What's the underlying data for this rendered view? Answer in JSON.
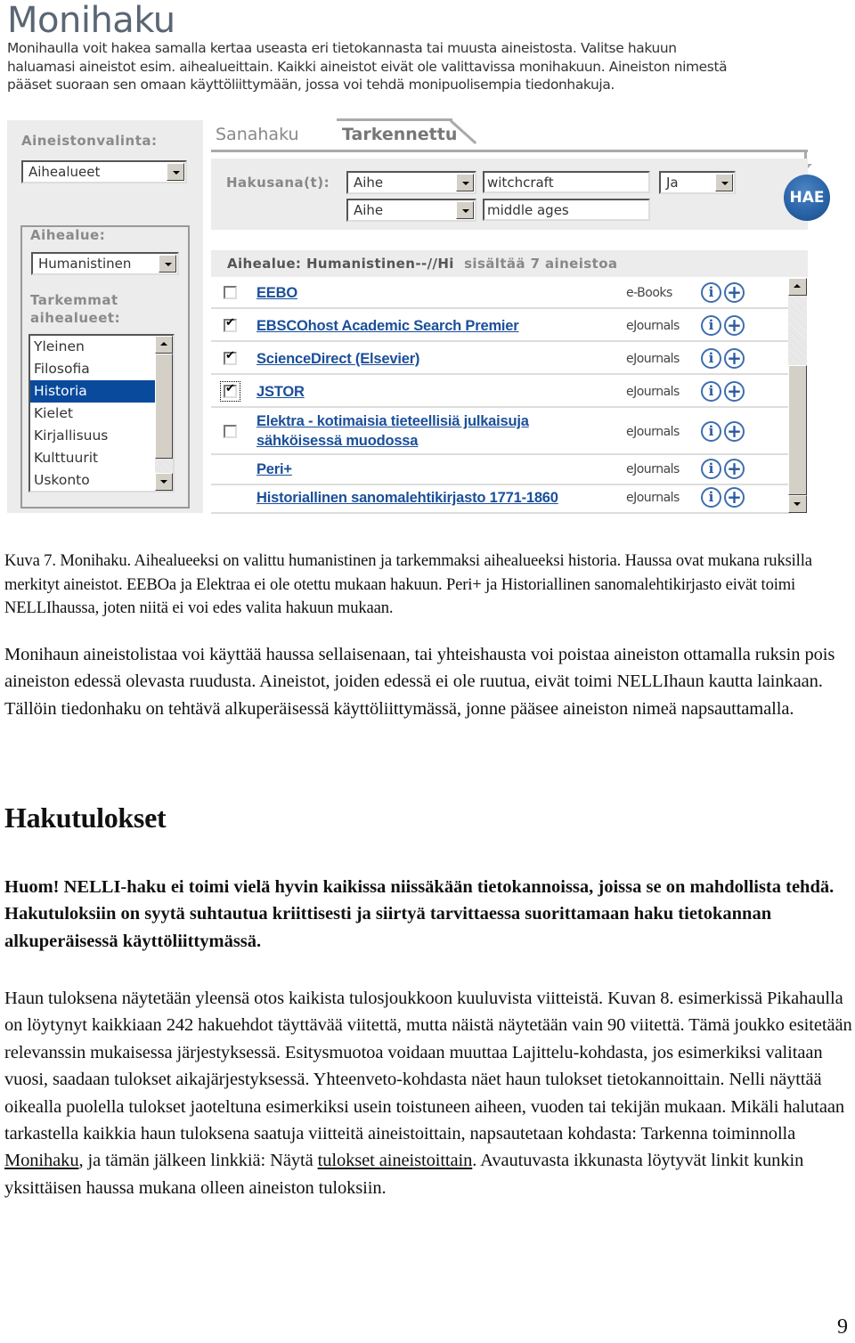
{
  "app": {
    "title": "Monihaku",
    "intro_lines": [
      "Monihaulla voit hakea samalla kertaa useasta eri tietokannasta tai muusta aineistosta. Valitse hakuun",
      "haluamasi aineistot esim. aihealueittain. Kaikki aineistot eivät ole valittavissa monihakuun. Aineiston nimestä",
      "pääset suoraan sen omaan käyttöliittymään, jossa voi tehdä monipuolisempia tiedonhakuja."
    ]
  },
  "left_panel": {
    "selection_label": "Aineistonvalinta:",
    "selection_value": "Aihealueet",
    "subject_label": "Aihealue:",
    "subject_value": "Humanistinen",
    "sub_subjects_label": "Tarkemmat aihealueet:",
    "sub_subjects": [
      "Yleinen",
      "Filosofia",
      "Historia",
      "Kielet",
      "Kirjallisuus",
      "Kulttuurit",
      "Uskonto"
    ],
    "selected_sub_subject": "Historia"
  },
  "tabs": [
    {
      "label": "Sanahaku",
      "active": false
    },
    {
      "label": "Tarkennettu",
      "active": true
    }
  ],
  "search": {
    "label": "Hakusana(t):",
    "rows": [
      {
        "field": "Aihe",
        "term": "witchcraft",
        "operator": "Ja"
      },
      {
        "field": "Aihe",
        "term": "middle ages"
      }
    ],
    "submit_label": "HAE"
  },
  "results": {
    "header_bold": "Aihealue: Humanistinen--//Hi",
    "header_rest": "sisältää 7 aineistoa",
    "items": [
      {
        "name": "EEBO",
        "type": "e-Books",
        "checkbox": true,
        "checked": false
      },
      {
        "name": "EBSCOhost Academic Search Premier",
        "type": "eJournals",
        "checkbox": true,
        "checked": true
      },
      {
        "name": "ScienceDirect (Elsevier)",
        "type": "eJournals",
        "checkbox": true,
        "checked": true
      },
      {
        "name": "JSTOR",
        "type": "eJournals",
        "checkbox": true,
        "checked": true,
        "focused": true
      },
      {
        "name_lines": [
          "Elektra - kotimaisia tieteellisiä julkaisuja",
          "sähköisessä muodossa"
        ],
        "type": "eJournals",
        "checkbox": true,
        "checked": false
      },
      {
        "name": "Peri+",
        "type": "eJournals",
        "checkbox": false
      },
      {
        "name": "Historiallinen sanomalehtikirjasto 1771-1860",
        "type": "eJournals",
        "checkbox": false
      }
    ],
    "info_icon": "i",
    "add_icon": "+"
  },
  "document": {
    "caption": "Kuva 7. Monihaku.  Aihealueeksi on valittu humanistinen ja tarkemmaksi aihealueeksi historia. Haussa ovat mukana ruksilla merkityt aineistot. EEBOa ja Elektraa ei ole otettu mukaan hakuun.  Peri+ ja Historiallinen sanomalehtikirjasto eivät toimi NELLIhaussa, joten niitä ei voi edes valita hakuun mukaan.",
    "paragraph1": "Monihaun aineistolistaa voi käyttää haussa sellaisenaan, tai yhteishausta voi poistaa aineiston ottamalla ruksin pois aineiston edessä olevasta ruudusta. Aineistot, joiden edessä ei ole ruutua, eivät toimi NELLIhaun kautta lainkaan. Tällöin tiedonhaku on tehtävä alkuperäisessä käyttöliittymässä, jonne pääsee aineiston nimeä napsauttamalla.",
    "heading": "Hakutulokset",
    "note": "Huom! NELLI-haku ei toimi vielä hyvin kaikissa niissäkään tietokannoissa, joissa se on mahdollista tehdä.  Hakutuloksiin on syytä suhtautua kriittisesti ja siirtyä tarvittaessa suorittamaan haku tietokannan alkuperäisessä käyttöliittymässä.",
    "paragraph2_part1": "Haun tuloksena näytetään yleensä otos kaikista tulosjoukkoon kuuluvista viitteistä. Kuvan 8. esimerkissä Pikahaulla on löytynyt kaikkiaan 242 hakuehdot täyttävää viitettä, mutta näistä näytetään vain 90 viitettä. Tämä joukko esitetään relevanssin mukaisessa järjestyksessä. Esitysmuotoa voidaan muuttaa Lajittelu-kohdasta, jos esimerkiksi valitaan vuosi, saadaan tulokset aikajärjestyksessä.  Yhteenveto-kohdasta näet haun tulokset tietokannoittain. Nelli näyttää oikealla puolella tulokset jaoteltuna esimerkiksi usein toistuneen aiheen, vuoden tai tekijän mukaan. Mikäli halutaan tarkastella kaikkia haun tuloksena saatuja viitteitä aineistoittain, napsautetaan kohdasta: Tarkenna toiminnolla ",
    "link1": "Monihaku",
    "paragraph2_part2": ", ja tämän jälkeen linkkiä: Näytä ",
    "link2": "tulokset aineistoittain",
    "paragraph2_part3": ". Avautuvasta ikkunasta löytyvät linkit kunkin yksittäisen haussa mukana olleen aineiston tuloksiin.",
    "page_number": "9"
  },
  "colors": {
    "link_blue": "#1a4f9a",
    "selected_bg": "#0a4a9c",
    "panel_gray": "#ececec",
    "hae_blue": "#2a64a8"
  }
}
